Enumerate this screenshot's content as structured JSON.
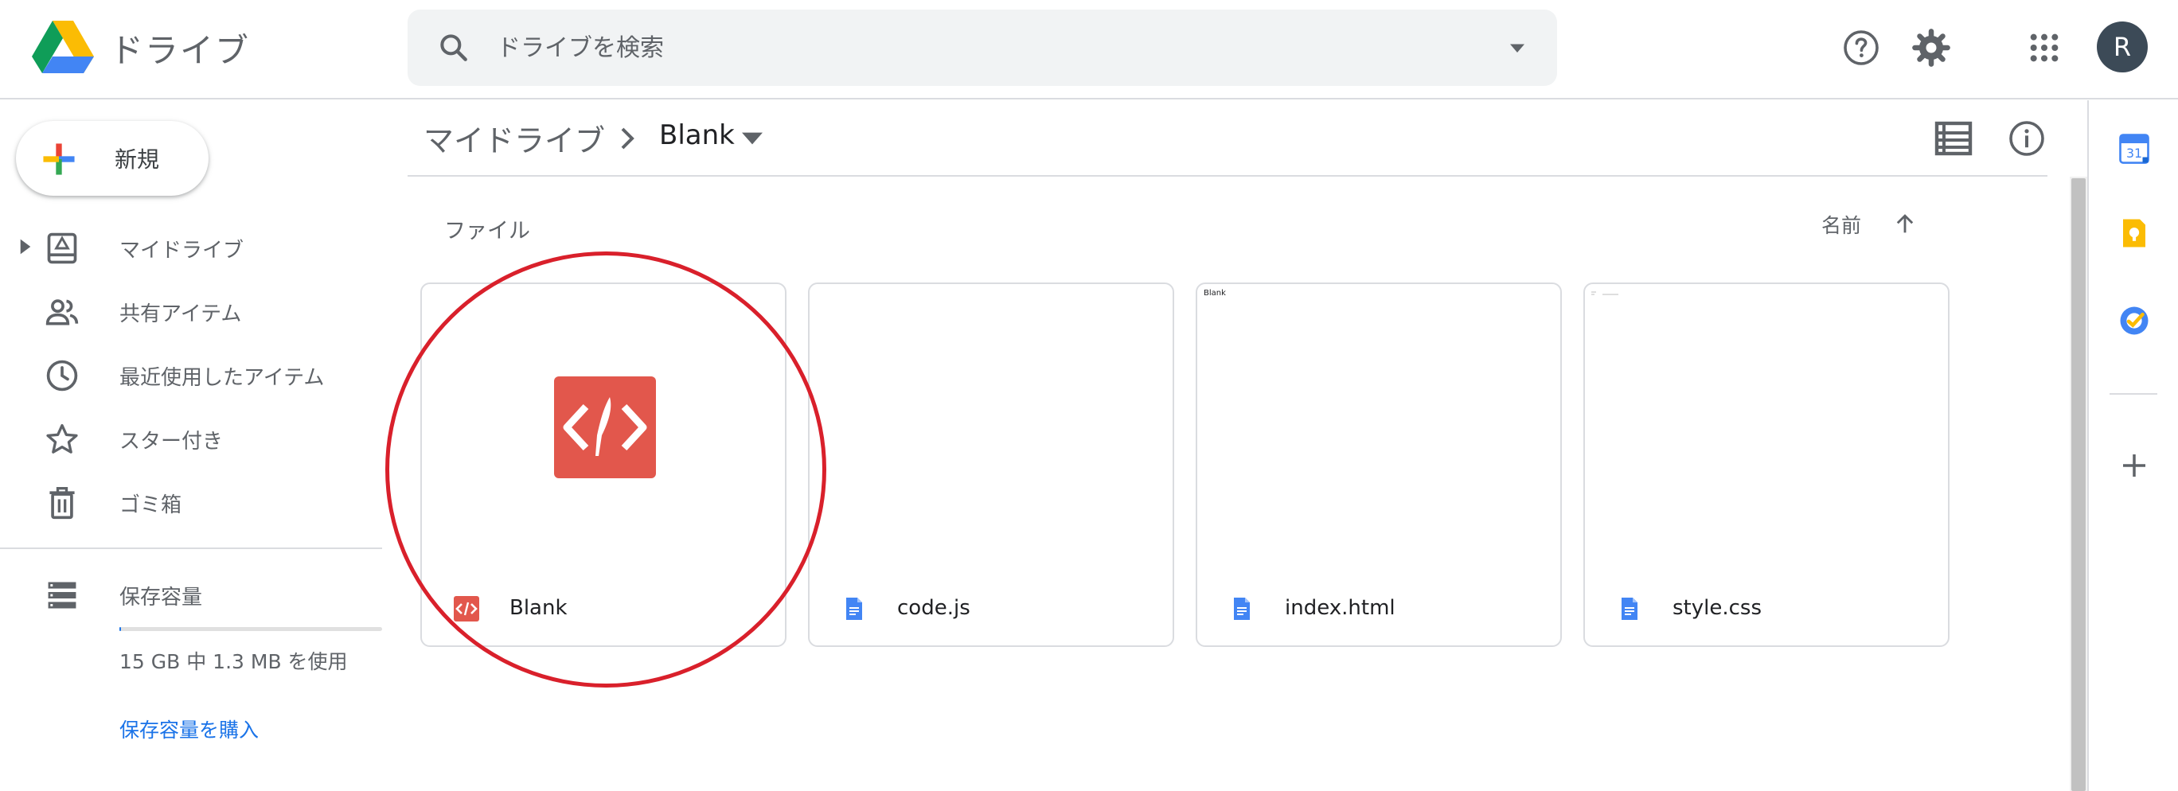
{
  "header": {
    "app_title": "ドライブ",
    "search": {
      "placeholder": "ドライブを検索",
      "value": ""
    },
    "avatar_initial": "R"
  },
  "sidebar": {
    "new_button_label": "新規",
    "items": [
      {
        "label": "マイドライブ",
        "icon": "my-drive-icon"
      },
      {
        "label": "共有アイテム",
        "icon": "people-icon"
      },
      {
        "label": "最近使用したアイテム",
        "icon": "clock-icon"
      },
      {
        "label": "スター付き",
        "icon": "star-icon"
      },
      {
        "label": "ゴミ箱",
        "icon": "trash-icon"
      }
    ],
    "storage": {
      "label": "保存容量",
      "usage_text": "15 GB 中 1.3 MB を使用",
      "used_fraction": 0.0001,
      "buy_label": "保存容量を購入"
    }
  },
  "breadcrumb": {
    "root": "マイドライブ",
    "current": "Blank"
  },
  "content": {
    "section_heading": "ファイル",
    "sort_label": "名前",
    "files": [
      {
        "name": "Blank",
        "icon": "apps-script-icon",
        "thumb_text": ""
      },
      {
        "name": "code.js",
        "icon": "document-icon",
        "thumb_text": ""
      },
      {
        "name": "index.html",
        "icon": "document-icon",
        "thumb_text": "Blank"
      },
      {
        "name": "style.css",
        "icon": "document-icon",
        "thumb_text": ""
      }
    ]
  },
  "side_panel": {
    "apps": [
      {
        "name": "calendar-icon",
        "badge": "31"
      },
      {
        "name": "keep-icon"
      },
      {
        "name": "tasks-icon"
      }
    ]
  },
  "colors": {
    "accent": "#1a73e8",
    "annotation": "#d9202b",
    "apps_script": "#e2574c",
    "avatar": "#3c4a57"
  }
}
